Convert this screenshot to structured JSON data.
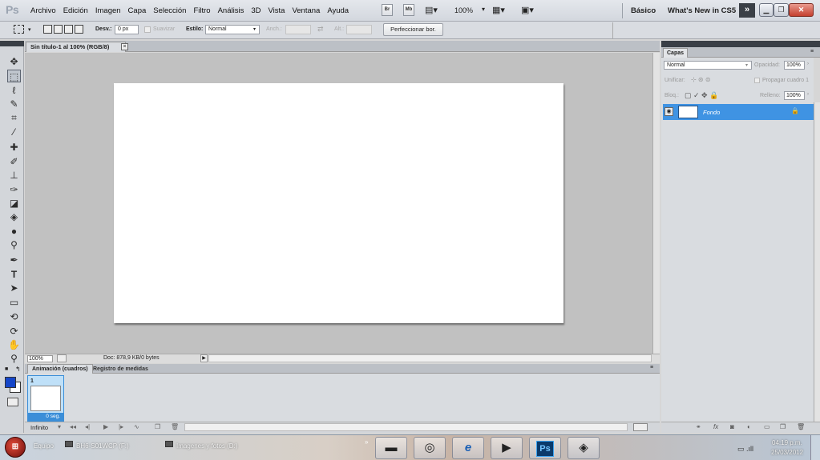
{
  "app": {
    "logo": "Ps"
  },
  "menu": [
    "Archivo",
    "Edición",
    "Imagen",
    "Capa",
    "Selección",
    "Filtro",
    "Análisis",
    "3D",
    "Vista",
    "Ventana",
    "Ayuda"
  ],
  "menubar": {
    "bridge_label": "Br",
    "minibridge_label": "Mb",
    "zoom": "100%",
    "workspace_basic": "Básico",
    "workspace_new": "What's New in CS5",
    "more_label": "»"
  },
  "options": {
    "feather_label": "Desv.:",
    "feather_value": "0 px",
    "antialias_label": "Suavizar",
    "style_label": "Estilo:",
    "style_value": "Normal",
    "width_label": "Anch.:",
    "height_label": "Alt.:",
    "refine_label": "Perfeccionar bor."
  },
  "document": {
    "tab_title": "Sin título-1 al 100% (RGB/8)",
    "zoom": "100%",
    "doc_info": "Doc: 878,9 KB/0 bytes"
  },
  "animation": {
    "tab_active": "Animación (cuadros)",
    "tab_other": "Registro de medidas",
    "frame_number": "1",
    "frame_time": "0 seg.",
    "loop": "Infinito"
  },
  "layers": {
    "tab": "Capas",
    "blend_mode": "Normal",
    "opacity_label": "Opacidad:",
    "opacity_value": "100%",
    "unify_label": "Unificar:",
    "propagate_label": "Propagar cuadro 1",
    "lock_label": "Bloq.:",
    "fill_label": "Relleno:",
    "fill_value": "100%",
    "layer_name": "Fondo"
  },
  "taskbar": {
    "item1": "BH6-S01WCP (F:)",
    "item2": "Imagenes y fotos (D:)",
    "clock_time": "04:19 p.m.",
    "clock_date": "25/03/2012"
  },
  "colors": {
    "foreground": "#1546c8",
    "background": "#ffffff",
    "selection": "#3f93e3"
  }
}
